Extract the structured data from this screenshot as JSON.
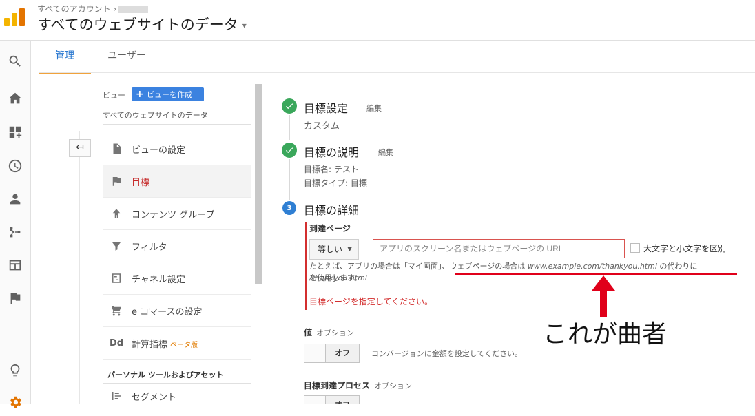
{
  "header": {
    "breadcrumb": "すべてのアカウント ›",
    "title": "すべてのウェブサイトのデータ",
    "title_caret": "▾"
  },
  "tabs": [
    {
      "label": "管理",
      "active": true
    },
    {
      "label": "ユーザー",
      "active": false
    }
  ],
  "view_panel": {
    "label": "ビュー",
    "create_button": "ビューを作成",
    "create_plus": "+",
    "view_name": "すべてのウェブサイトのデータ",
    "back_icon": "↤",
    "items": [
      {
        "label": "ビューの設定",
        "icon": "document-icon"
      },
      {
        "label": "目標",
        "icon": "flag-icon",
        "selected": true
      },
      {
        "label": "コンテンツ グループ",
        "icon": "grouping-icon"
      },
      {
        "label": "フィルタ",
        "icon": "filter-icon"
      },
      {
        "label": "チャネル設定",
        "icon": "channel-icon"
      },
      {
        "label": "e コマースの設定",
        "icon": "cart-icon"
      },
      {
        "label": "計算指標",
        "icon": "dd-icon",
        "icon_text": "Dd",
        "badge": "ベータ版"
      }
    ],
    "section_header": "パーソナル ツールおよびアセット",
    "section_items": [
      {
        "label": "セグメント",
        "icon": "segment-icon"
      }
    ]
  },
  "steps": {
    "step1": {
      "title": "目標設定",
      "edit": "編集",
      "sub": "カスタム"
    },
    "step2": {
      "title": "目標の説明",
      "edit": "編集",
      "sub1": "目標名: テスト",
      "sub2": "目標タイプ: 目標"
    },
    "step3": {
      "number": "3",
      "title": "目標の詳細"
    }
  },
  "destination": {
    "label": "到達ページ",
    "match_type": "等しい",
    "url_placeholder": "アプリのスクリーン名またはウェブページの URL",
    "case_sensitive_label": "大文字と小文字を区別",
    "help_part1": "たとえば、アプリの場合は「マイ画面」、ウェブページの場合は ",
    "help_example_url": "www.example.com/thankyou.html",
    "help_part2": " の代わりに ",
    "help_example_path": "/thankyou.html",
    "help_line2": "を使用します。",
    "error": "目標ページを指定してください。"
  },
  "value": {
    "label": "値",
    "optional": "オプション",
    "toggle": "オフ",
    "description": "コンバージョンに金額を設定してください。"
  },
  "funnel": {
    "label": "目標到達プロセス",
    "optional": "オプション",
    "toggle": "オフ"
  },
  "annotation": {
    "note": "これが曲者",
    "color": "#e0001a"
  },
  "colors": {
    "accent": "#2a78d0",
    "tab_underline": "#f1a33c",
    "success": "#3aa75b",
    "error": "#d32f2f"
  }
}
